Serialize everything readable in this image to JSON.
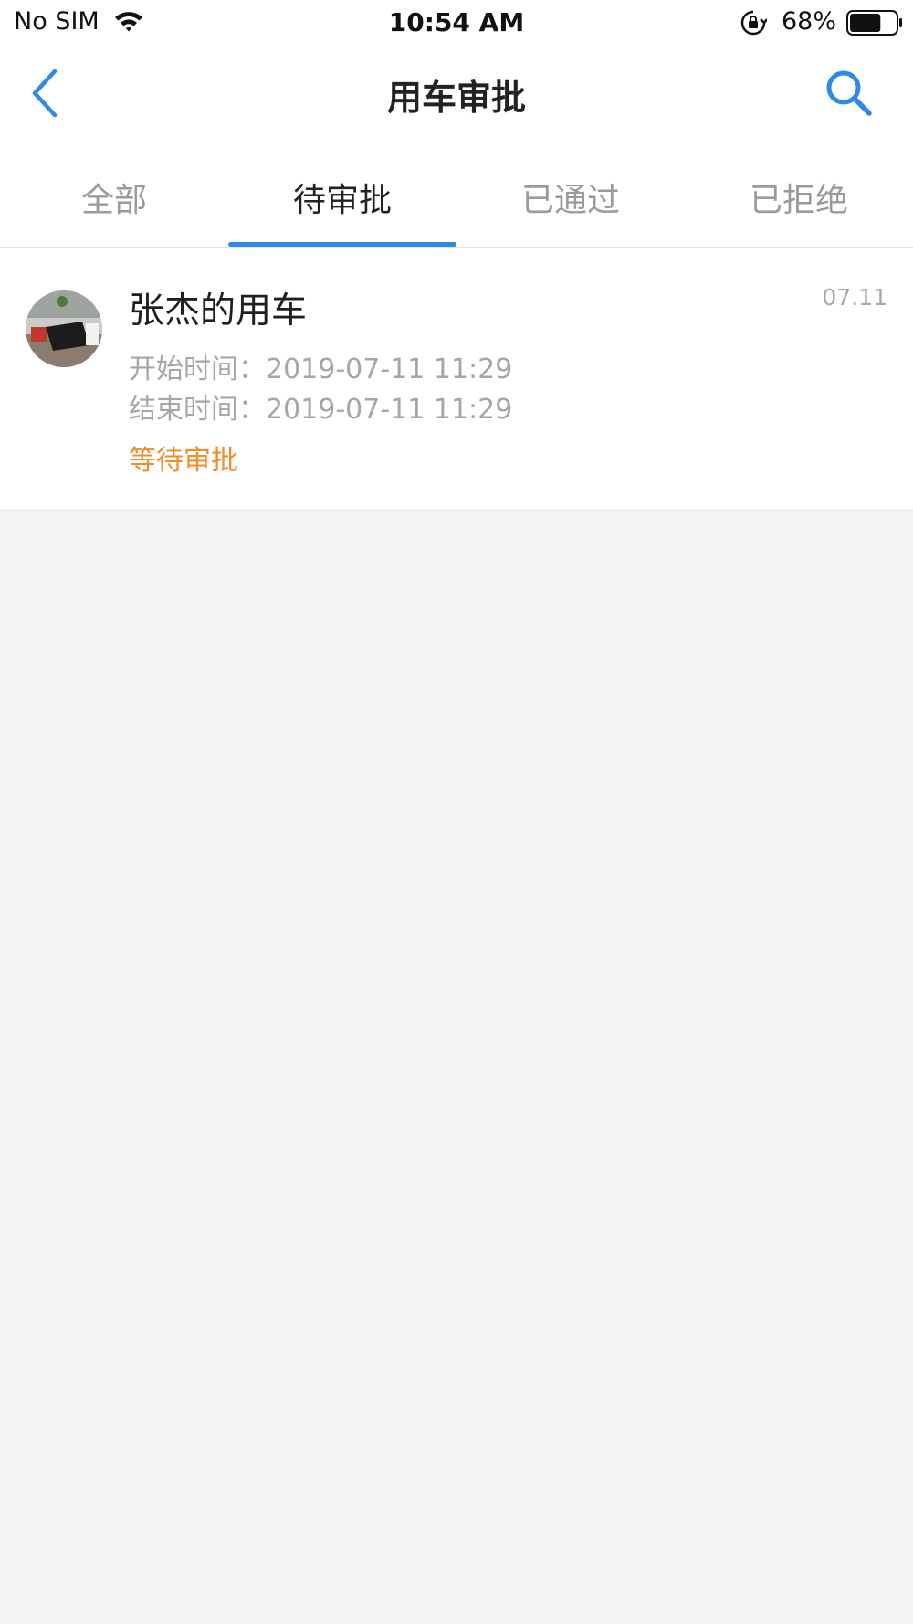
{
  "status_bar": {
    "carrier": "No SIM",
    "time": "10:54 AM",
    "battery_percent": "68%",
    "battery_level": 0.68,
    "icons": [
      "wifi-icon",
      "orientation-lock-icon",
      "battery-icon"
    ]
  },
  "nav": {
    "title": "用车审批",
    "back_icon": "chevron-left-icon",
    "search_icon": "search-icon"
  },
  "tabs": [
    {
      "label": "全部",
      "active": false
    },
    {
      "label": "待审批",
      "active": true
    },
    {
      "label": "已通过",
      "active": false
    },
    {
      "label": "已拒绝",
      "active": false
    }
  ],
  "items": [
    {
      "title": "张杰的用车",
      "date": "07.11",
      "start": "开始时间：2019-07-11 11:29",
      "end": "结束时间：2019-07-11 11:29",
      "status": "等待审批"
    }
  ],
  "colors": {
    "accent": "#2f8ae5",
    "pending": "#f08c2a",
    "background": "#f4f4f5"
  }
}
